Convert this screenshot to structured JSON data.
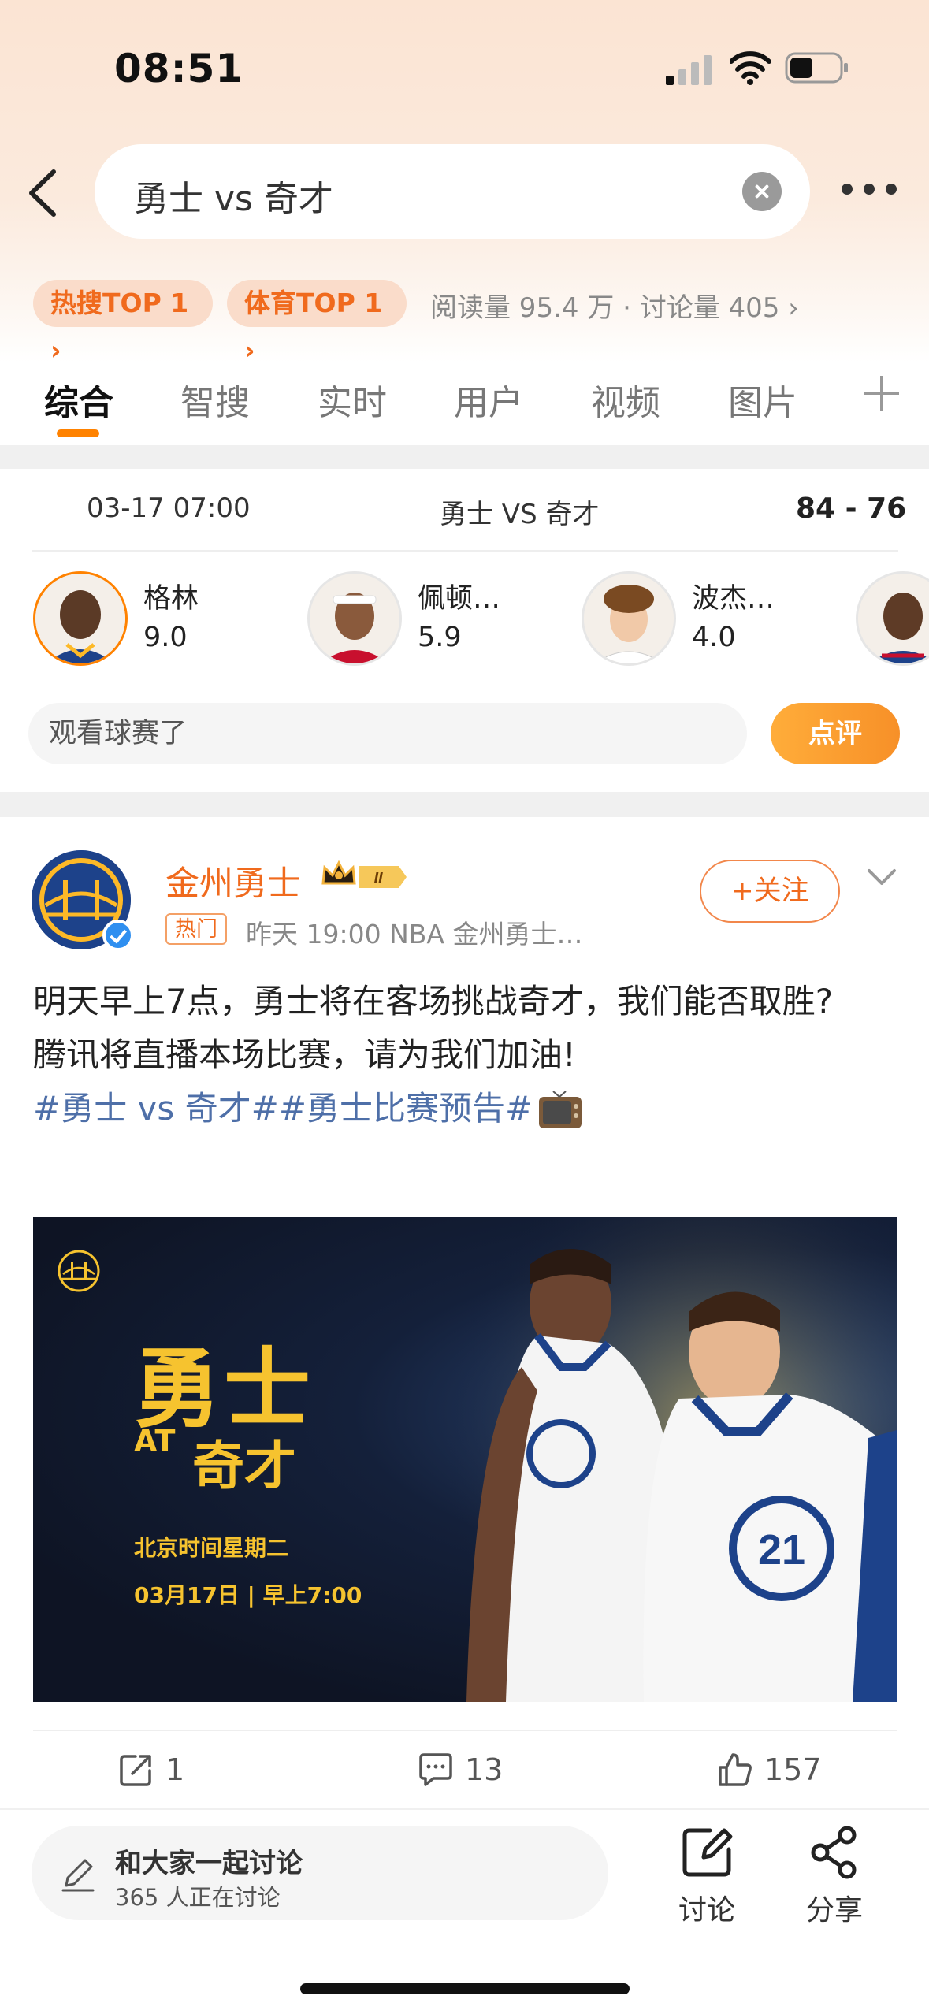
{
  "status_bar": {
    "time": "08:51"
  },
  "search": {
    "query": "勇士 vs 奇才"
  },
  "badges": {
    "hot": "热搜TOP 1 ›",
    "sport": "体育TOP 1 ›"
  },
  "stats": {
    "text": "阅读量 95.4 万 · 讨论量 405 ›"
  },
  "tabs": [
    {
      "label": "综合"
    },
    {
      "label": "智搜"
    },
    {
      "label": "实时"
    },
    {
      "label": "用户"
    },
    {
      "label": "视频"
    },
    {
      "label": "图片"
    }
  ],
  "game": {
    "date": "03-17 07:00",
    "matchup": "勇士 VS 奇才",
    "score": "84 - 76",
    "players": [
      {
        "name": "格林",
        "score": "9.0"
      },
      {
        "name": "佩顿…",
        "score": "5.9"
      },
      {
        "name": "波杰…",
        "score": "4.0"
      }
    ],
    "comment_placeholder": "观看球赛了",
    "rate_label": "点评"
  },
  "post": {
    "author": "金州勇士",
    "level": "II",
    "hot_tag": "热门",
    "meta": "昨天 19:00  NBA 金州勇士…",
    "follow_label": "+关注",
    "text_line1": "明天早上7点，勇士将在客场挑战奇才，我们能否取胜?",
    "text_line2": "腾讯将直播本场比赛，请为我们加油!",
    "hashtags": "#勇士 vs 奇才##勇士比赛预告#",
    "image": {
      "title": "勇士",
      "at": "AT",
      "opponent": "奇才",
      "line1": "北京时间星期二",
      "line2": "03月17日 | 早上7:00"
    },
    "actions": {
      "repost": "1",
      "comment": "13",
      "like": "157"
    }
  },
  "bottom": {
    "discuss_main": "和大家一起讨论",
    "discuss_sub": "365 人正在讨论",
    "discuss_label": "讨论",
    "share_label": "分享"
  },
  "colors": {
    "accent": "#ff8200",
    "author": "#f06a1d",
    "hashtag": "#4e6fa8",
    "poster_text": "#f6c32f"
  }
}
